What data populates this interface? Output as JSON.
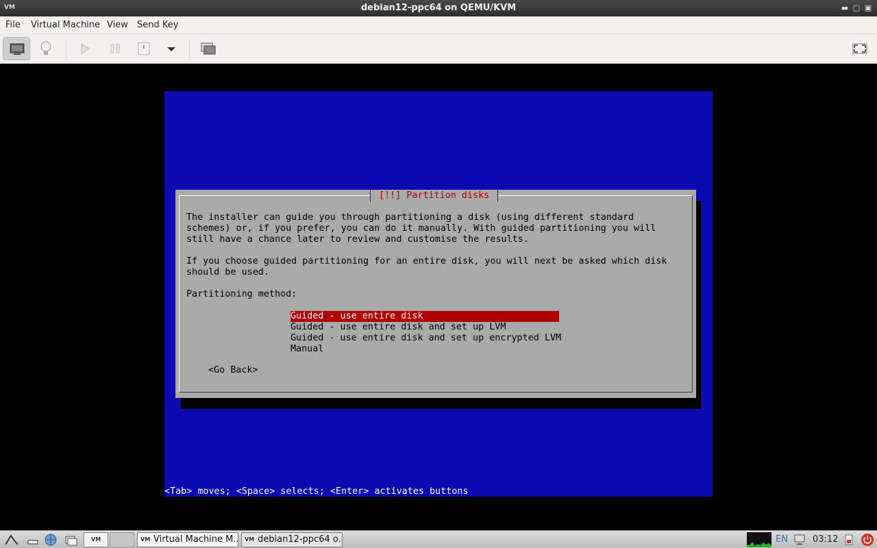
{
  "window": {
    "title": "debian12-ppc64 on QEMU/KVM",
    "app_icon": "virt-manager-icon",
    "buttons": [
      "minimize-icon",
      "maximize-icon",
      "close-icon"
    ]
  },
  "menubar": {
    "items": [
      "File",
      "Virtual Machine",
      "View",
      "Send Key"
    ]
  },
  "toolbar": {
    "buttons": [
      "console-icon",
      "details-lightbulb-icon",
      "run-icon",
      "pause-icon",
      "shutdown-icon",
      "shutdown-menu-chevron-icon",
      "snapshots-icon"
    ],
    "fullscreen": "fullscreen-icon"
  },
  "installer": {
    "dialog_title": "[!!] Partition disks",
    "paragraph1": [
      "The installer can guide you through partitioning a disk (using different standard",
      "schemes) or, if you prefer, you can do it manually. With guided partitioning you will",
      "still have a chance later to review and customise the results."
    ],
    "paragraph2": [
      "If you choose guided partitioning for an entire disk, you will next be asked which disk",
      "should be used."
    ],
    "prompt": "Partitioning method:",
    "options": [
      "Guided - use entire disk",
      "Guided - use entire disk and set up LVM",
      "Guided - use entire disk and set up encrypted LVM",
      "Manual"
    ],
    "selected_index": 0,
    "go_back": "<Go Back>",
    "hint": "<Tab> moves; <Space> selects; <Enter> activates buttons",
    "colors": {
      "background": "#0a0ab0",
      "dialog": "#aaaaaa",
      "title_text": "#b00000",
      "selection": "#b00000"
    }
  },
  "taskbar": {
    "tasks": [
      {
        "label": "Virtual Machine M...",
        "icon": "virt-manager-icon"
      },
      {
        "label": "debian12-ppc64 o...",
        "icon": "virt-manager-icon"
      }
    ],
    "keyboard_layout": "EN",
    "clock": "03:12"
  }
}
